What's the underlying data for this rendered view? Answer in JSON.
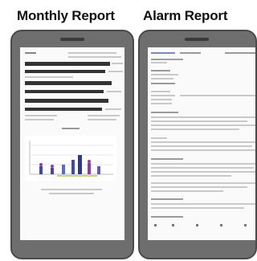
{
  "labels": {
    "monthly": "Monthly Report",
    "alarm": "Alarm Report"
  },
  "colors": {
    "phone_body": "#6e6e6e",
    "screen_bg": "#fafafa",
    "chart_bar": "#3f4aa8",
    "chart_accent": "#8a3ea8"
  }
}
